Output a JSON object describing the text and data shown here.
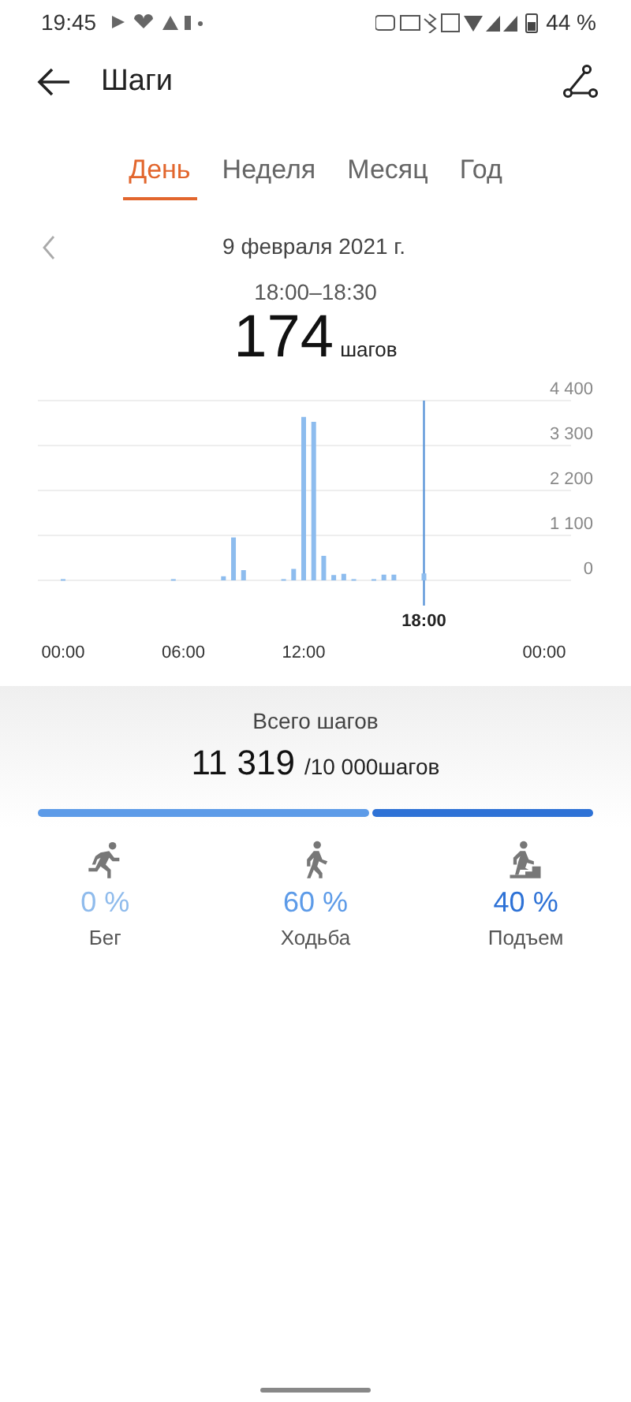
{
  "status_bar": {
    "time": "19:45",
    "battery": "44 %"
  },
  "header": {
    "title": "Шаги"
  },
  "tabs": [
    {
      "label": "День",
      "selected": true
    },
    {
      "label": "Неделя",
      "selected": false
    },
    {
      "label": "Месяц",
      "selected": false
    },
    {
      "label": "Год",
      "selected": false
    }
  ],
  "date": "9 февраля 2021 г.",
  "selection": {
    "range": "18:00–18:30",
    "value": "174",
    "unit": "шагов"
  },
  "chart_data": {
    "type": "bar",
    "x": [
      0,
      0.5,
      1,
      1.5,
      2,
      2.5,
      3,
      3.5,
      4,
      4.5,
      5,
      5.5,
      6,
      6.5,
      7,
      7.5,
      8,
      8.5,
      9,
      9.5,
      10,
      10.5,
      11,
      11.5,
      12,
      12.5,
      13,
      13.5,
      14,
      14.5,
      15,
      15.5,
      16,
      16.5,
      17,
      17.5,
      18,
      18.5,
      19,
      19.5,
      20,
      20.5,
      21,
      21.5,
      22,
      22.5,
      23,
      23.5
    ],
    "series": [
      {
        "color": "#8dbcee",
        "values": [
          30,
          0,
          0,
          0,
          0,
          0,
          0,
          0,
          0,
          0,
          0,
          30,
          0,
          0,
          0,
          0,
          100,
          1050,
          250,
          0,
          0,
          0,
          30,
          280,
          4000,
          3880,
          600,
          130,
          160,
          30,
          0,
          30,
          140,
          140,
          0,
          0,
          170,
          0,
          0,
          0,
          0,
          0,
          0,
          0,
          0,
          0,
          0,
          0
        ]
      }
    ],
    "grid": true,
    "ref_lines": [
      {
        "axis": "x",
        "value": 18,
        "label": "18:00",
        "color": "#5b95d8"
      }
    ],
    "ylim": [
      0,
      4400
    ],
    "yticks": [
      {
        "value": 4400,
        "label": "4 400"
      },
      {
        "value": 3300,
        "label": "3 300"
      },
      {
        "value": 2200,
        "label": "2 200"
      },
      {
        "value": 1100,
        "label": "1 100"
      },
      0
    ],
    "xlim": [
      0,
      24
    ],
    "xticks": [
      {
        "value": 0,
        "label": "00:00"
      },
      {
        "value": 6,
        "label": "06:00"
      },
      {
        "value": 12,
        "label": "12:00"
      },
      {
        "value": 24,
        "label": "00:00"
      }
    ]
  },
  "total": {
    "label": "Всего шагов",
    "value": "11 319",
    "goal": "/10 000шагов"
  },
  "activities": [
    {
      "kind": "run",
      "percent": "0 %",
      "label": "Бег",
      "color": "#8fbbec"
    },
    {
      "kind": "walk",
      "percent": "60 %",
      "label": "Ходьба",
      "color": "#5d9be8"
    },
    {
      "kind": "climb",
      "percent": "40 %",
      "label": "Подъем",
      "color": "#2e72d6"
    }
  ]
}
